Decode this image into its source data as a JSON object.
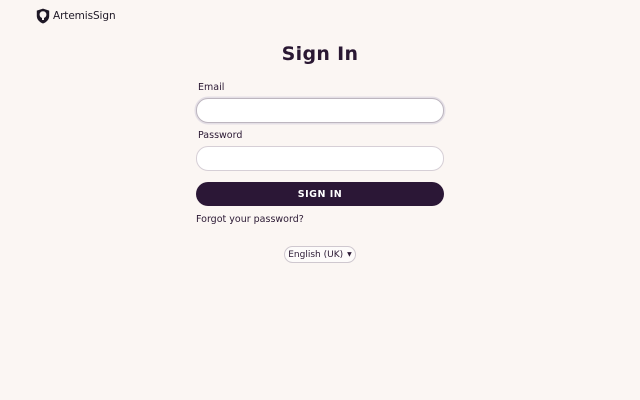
{
  "brand": {
    "logo_icon": "shield-icon",
    "name": "ArtemisSign"
  },
  "page": {
    "title": "Sign In"
  },
  "form": {
    "email_label": "Email",
    "email_value": "",
    "email_placeholder": "",
    "password_label": "Password",
    "password_value": "",
    "password_placeholder": "",
    "submit_label": "SIGN IN",
    "forgot_label": "Forgot your password?"
  },
  "language": {
    "selected": "English (UK)",
    "icon": "caret-down-icon"
  },
  "colors": {
    "background": "#fbf6f3",
    "accent": "#2b1736",
    "text": "#2a1833"
  }
}
